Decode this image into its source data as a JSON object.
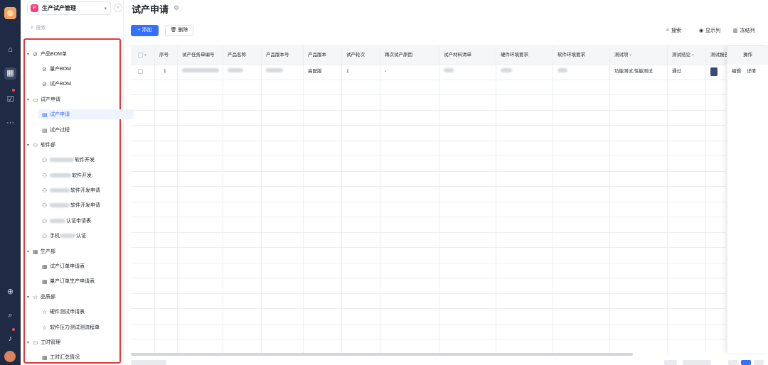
{
  "app": {
    "name": "生产试产管理",
    "icon_letter": "P",
    "brand_color": "#f0427c"
  },
  "rail": {
    "icons": [
      "home-icon",
      "grid-icon",
      "checklist-icon",
      "more-icon",
      "add-icon",
      "search-icon",
      "bell-icon"
    ],
    "more_label": "···"
  },
  "search": {
    "placeholder": "搜索"
  },
  "tree": {
    "groups": [
      {
        "label": "产品BOM单",
        "icon": "bom-icon"
      },
      {
        "label": "试产申请",
        "icon": "folder-icon"
      },
      {
        "label": "软件部",
        "icon": "dept-icon"
      },
      {
        "label": "生产部",
        "icon": "grid-icon"
      },
      {
        "label": "品质部",
        "icon": "star-icon"
      },
      {
        "label": "工时管理",
        "icon": "folder-icon"
      }
    ],
    "leaves": {
      "bom_mass": "量产BOM",
      "bom_trial": "试产BOM",
      "trial_apply": "试产申请",
      "trial_process": "试产过程",
      "sw1": "软件开发",
      "sw2": "软件开发",
      "sw3": "软件开发申请",
      "sw4": "软件开发申请",
      "sw5": "认证申请表",
      "sw6_prefix": "手机",
      "sw6_suffix": "认证",
      "prod1": "试产订单申请表",
      "prod2": "量产订单生产申请表",
      "qa1": "硬件测试申请表",
      "qa2": "软件压力测试测流程单",
      "time1": "工时汇总情况"
    }
  },
  "main": {
    "title": "试产申请",
    "add_label": "+ 添加",
    "delete_label": "删除",
    "tools": {
      "search": "搜索",
      "columns": "显示列",
      "freeze": "冻结列"
    }
  },
  "table": {
    "headers": {
      "index": "序号",
      "task_no": "试产任务单编号",
      "product_name": "产品名称",
      "version_no": "产品版本号",
      "version": "产品版本",
      "round": "试产轮次",
      "reason": "再次试产原因",
      "material": "试产材料清单",
      "hw_env": "硬件环境要求",
      "sw_env": "软件环境要求",
      "test_item": "测试项",
      "test_result": "测试结论",
      "test_report": "测试报告",
      "ops": "操作"
    },
    "row": {
      "index": "1",
      "version": "高配版",
      "round": "1",
      "reason": "-",
      "test_item": "功能测试,性能测试",
      "test_result": "通过",
      "edit": "编辑",
      "detail": "详情"
    }
  },
  "colors": {
    "accent": "#3370ff",
    "rail": "#1f2a44",
    "highlight_border": "#e03a3a"
  }
}
